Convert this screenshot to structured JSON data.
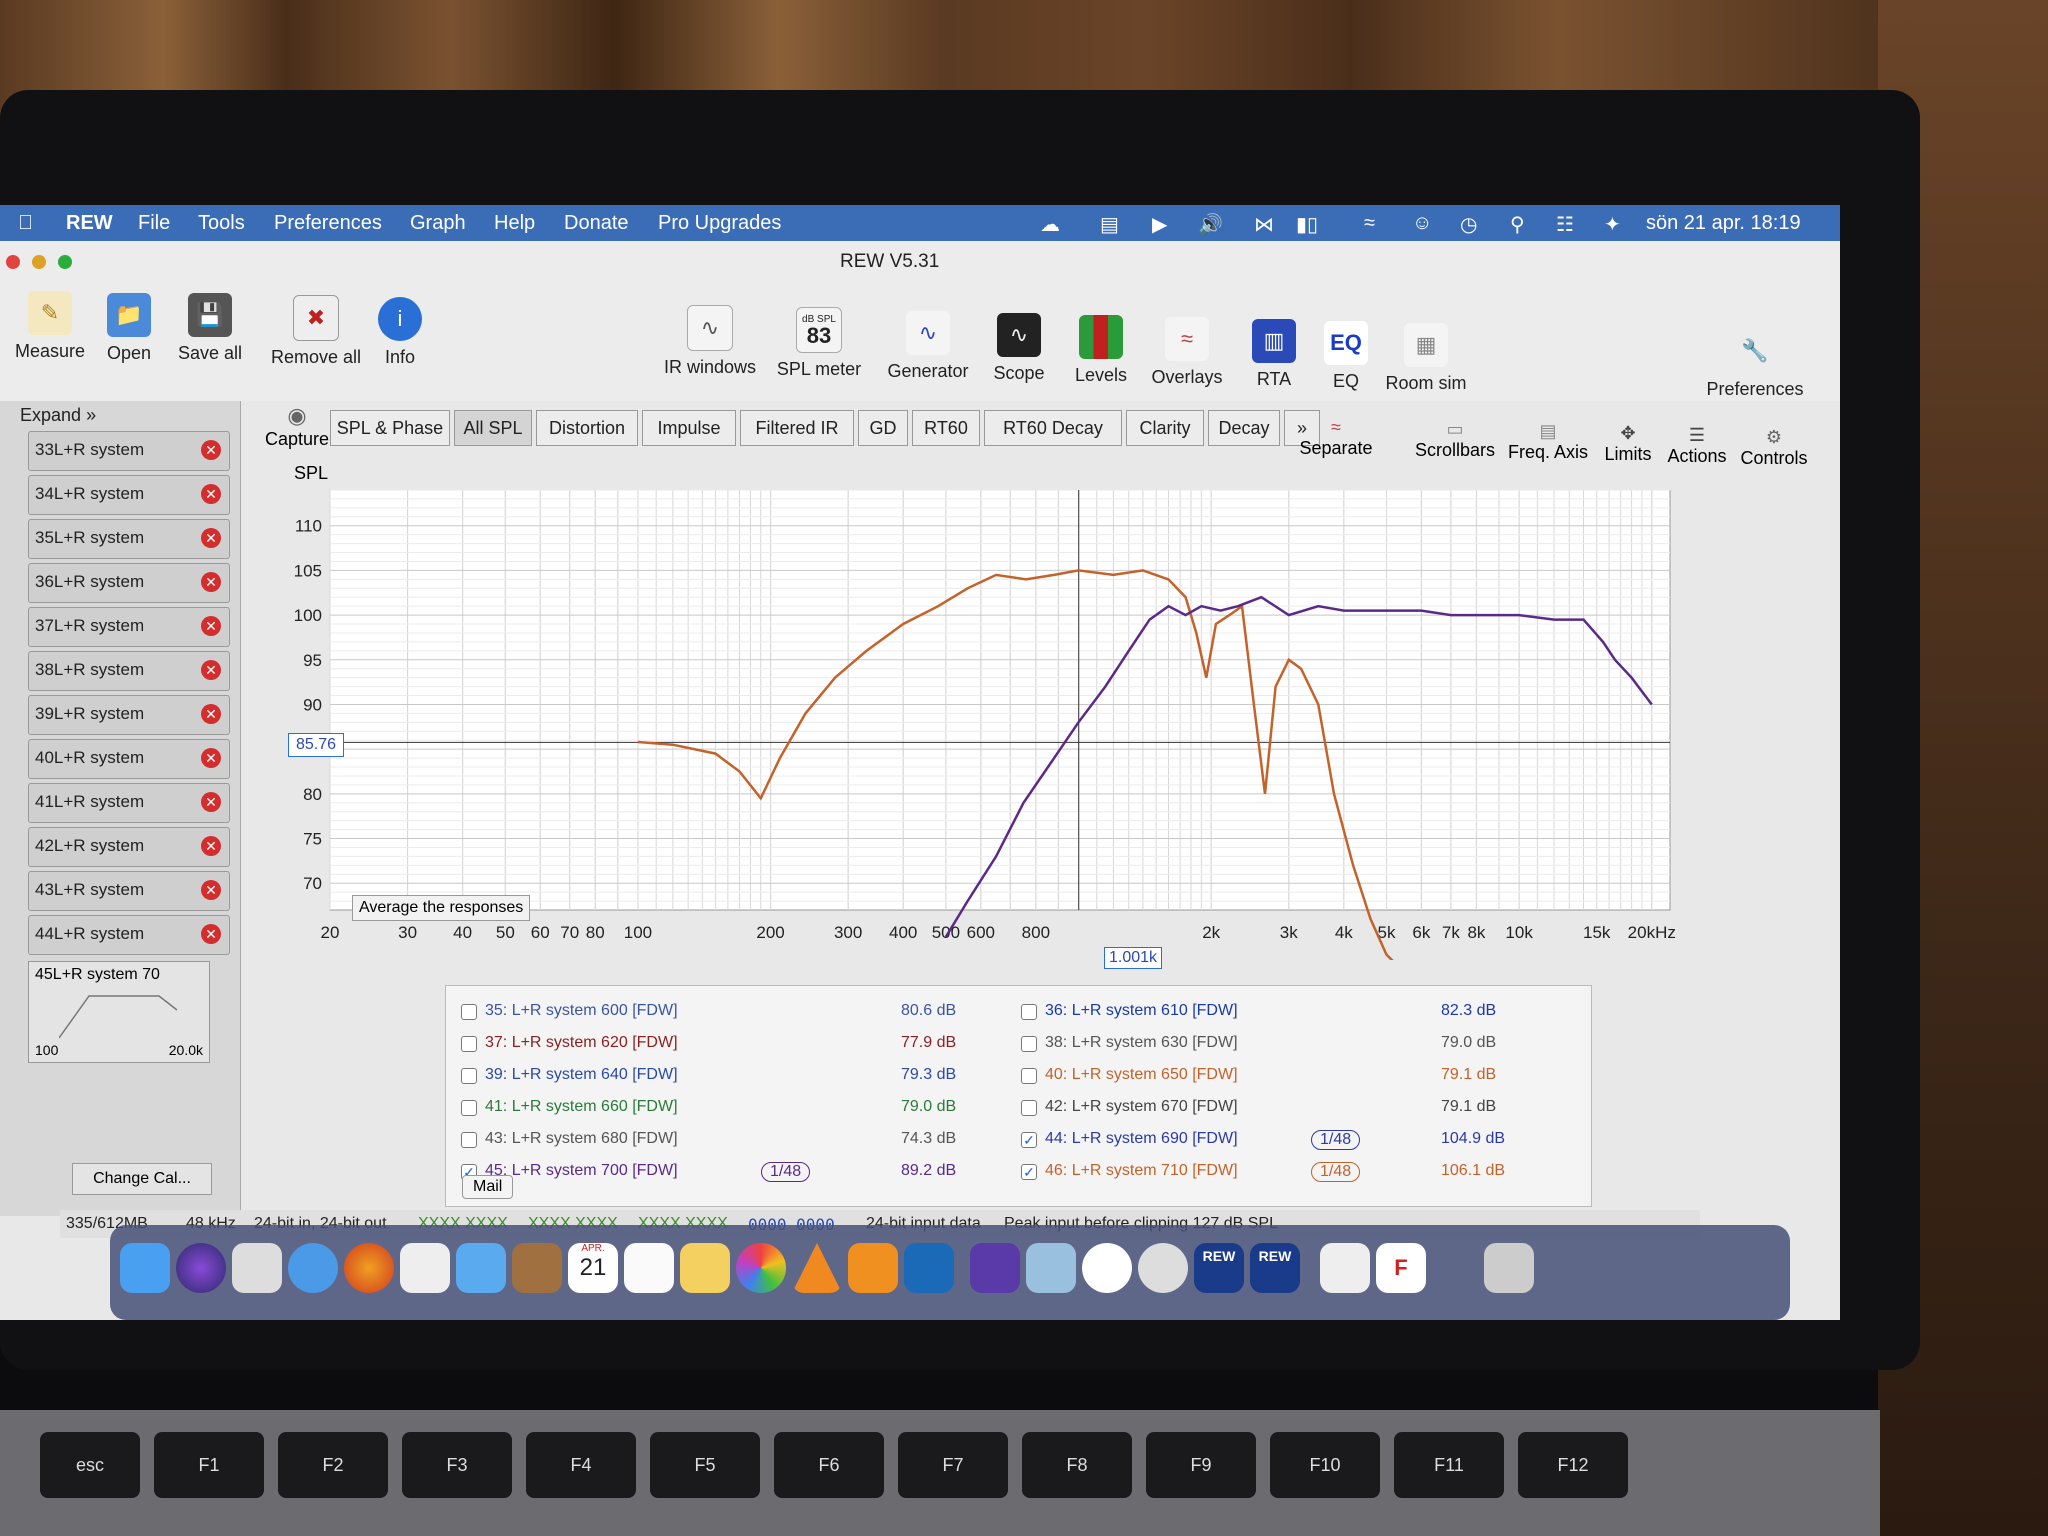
{
  "menubar": {
    "app": "REW",
    "items": [
      "File",
      "Tools",
      "Preferences",
      "Graph",
      "Help",
      "Donate",
      "Pro Upgrades"
    ],
    "clock": "sön 21 apr.  18:19"
  },
  "window": {
    "title": "REW V5.31"
  },
  "toolbar": {
    "left": [
      {
        "label": "Measure",
        "icon": "measure-icon"
      },
      {
        "label": "Open",
        "icon": "folder-icon"
      },
      {
        "label": "Save all",
        "icon": "save-icon"
      },
      {
        "label": "Remove all",
        "icon": "remove-icon"
      },
      {
        "label": "Info",
        "icon": "info-icon"
      }
    ],
    "center": [
      {
        "label": "IR windows",
        "icon": "ir-windows-icon"
      },
      {
        "label": "SPL meter",
        "icon": "spl-meter-icon",
        "value": "83",
        "unit": "dB SPL"
      },
      {
        "label": "Generator",
        "icon": "generator-icon"
      },
      {
        "label": "Scope",
        "icon": "scope-icon"
      },
      {
        "label": "Levels",
        "icon": "levels-icon"
      },
      {
        "label": "Overlays",
        "icon": "overlays-icon"
      },
      {
        "label": "RTA",
        "icon": "rta-icon"
      },
      {
        "label": "EQ",
        "icon": "eq-icon"
      },
      {
        "label": "Room sim",
        "icon": "room-sim-icon"
      }
    ],
    "right": {
      "label": "Preferences",
      "icon": "wrench-icon"
    }
  },
  "leftpanel": {
    "expand": "Expand",
    "measurements": [
      "33L+R system",
      "34L+R system",
      "35L+R system",
      "36L+R system",
      "37L+R system",
      "38L+R system",
      "39L+R system",
      "40L+R system",
      "41L+R system",
      "42L+R system",
      "43L+R system",
      "44L+R system"
    ],
    "selected": {
      "name": "45L+R system 70",
      "range_low": "100",
      "range_high": "20.0k"
    },
    "change_cal": "Change Cal..."
  },
  "graph_tabs": {
    "capture": "Capture",
    "tabs": [
      "SPL & Phase",
      "All SPL",
      "Distortion",
      "Impulse",
      "Filtered IR",
      "GD",
      "RT60",
      "RT60 Decay",
      "Clarity",
      "Decay",
      "»"
    ],
    "selected": "All SPL"
  },
  "graph_tools": [
    {
      "label": "Separate"
    },
    {
      "label": "Scrollbars"
    },
    {
      "label": "Freq. Axis"
    },
    {
      "label": "Limits"
    },
    {
      "label": "Actions"
    },
    {
      "label": "Controls"
    }
  ],
  "graph": {
    "ylabel": "SPL",
    "cursor_value": "85.76",
    "cursor_freq": "1.001k",
    "average_button": "Average the responses"
  },
  "chart_data": {
    "type": "line",
    "ylabel": "SPL",
    "xlabel": "",
    "x_unit": "kHz",
    "y_ticks": [
      "110",
      "105",
      "100",
      "95",
      "90",
      "80",
      "75",
      "70"
    ],
    "x_ticks": [
      "20",
      "30",
      "40",
      "50",
      "60",
      "70",
      "80",
      "100",
      "200",
      "300",
      "400",
      "500",
      "600",
      "800",
      "2k",
      "3k",
      "4k",
      "5k",
      "6k",
      "7k",
      "8k",
      "10k",
      "15k",
      "20kHz"
    ],
    "ylim": [
      67,
      114
    ],
    "xlim": [
      20,
      22000
    ],
    "x_scale": "log",
    "grid": true,
    "series": [
      {
        "color": "#c4622a",
        "x": [
          100,
          120,
          150,
          170,
          190,
          210,
          240,
          280,
          330,
          400,
          480,
          560,
          650,
          760,
          880,
          1000,
          1200,
          1400,
          1600,
          1750,
          1850,
          1950,
          2050,
          2200,
          2350,
          2500,
          2650,
          2800,
          3000,
          3200,
          3500,
          3800,
          4200,
          4600,
          5000,
          5500
        ],
        "y": [
          85.8,
          85.5,
          84.5,
          82.5,
          79.5,
          84,
          89,
          93,
          96,
          99,
          101,
          103,
          104.5,
          104,
          104.5,
          105,
          104.5,
          105,
          104,
          102,
          98,
          93,
          99,
          100,
          101,
          90,
          80,
          92,
          95,
          94,
          90,
          80,
          72,
          66,
          62,
          60
        ]
      },
      {
        "color": "#5a2a8a",
        "x": [
          500,
          560,
          650,
          750,
          880,
          1000,
          1150,
          1300,
          1450,
          1600,
          1750,
          1900,
          2100,
          2300,
          2600,
          3000,
          3500,
          4000,
          5000,
          6000,
          7000,
          8000,
          10000,
          12000,
          14000,
          15500,
          16500,
          18000,
          20000
        ],
        "y": [
          64,
          68,
          73,
          79,
          84,
          88,
          92,
          96,
          99.5,
          101,
          100,
          101,
          100.5,
          101,
          102,
          100,
          101,
          100.5,
          100.5,
          100.5,
          100,
          100,
          100,
          99.5,
          99.5,
          97,
          95,
          93,
          90
        ]
      }
    ]
  },
  "measurement_list": {
    "left": [
      {
        "name": "35: L+R system 600 [FDW]",
        "value": "80.6 dB",
        "color": "#3a55a0",
        "checked": false
      },
      {
        "name": "37: L+R system 620 [FDW]",
        "value": "77.9 dB",
        "color": "#8a2222",
        "checked": false
      },
      {
        "name": "39: L+R system 640 [FDW]",
        "value": "79.3 dB",
        "color": "#2a4aa8",
        "checked": false
      },
      {
        "name": "41: L+R system 660 [FDW]",
        "value": "79.0 dB",
        "color": "#2a7a3a",
        "checked": false
      },
      {
        "name": "43: L+R system 680 [FDW]",
        "value": "74.3 dB",
        "color": "#555555",
        "checked": false
      },
      {
        "name": "45: L+R system 700 [FDW]",
        "value": "89.2 dB",
        "color": "#5a2a8a",
        "checked": true,
        "smoothing": "1/48"
      }
    ],
    "right": [
      {
        "name": "36: L+R system 610 [FDW]",
        "value": "82.3 dB",
        "color": "#1a3aaa",
        "checked": false
      },
      {
        "name": "38: L+R system 630 [FDW]",
        "value": "79.0 dB",
        "color": "#555555",
        "checked": false
      },
      {
        "name": "40: L+R system 650 [FDW]",
        "value": "79.1 dB",
        "color": "#c4622a",
        "checked": false
      },
      {
        "name": "42: L+R system 670 [FDW]",
        "value": "79.1 dB",
        "color": "#444444",
        "checked": false
      },
      {
        "name": "44: L+R system 690 [FDW]",
        "value": "104.9 dB",
        "color": "#2a3aa8",
        "checked": true,
        "smoothing": "1/48"
      },
      {
        "name": "46: L+R system 710 [FDW]",
        "value": "106.1 dB",
        "color": "#c4622a",
        "checked": true,
        "smoothing": "1/48"
      }
    ]
  },
  "tooltip": "Mail",
  "status": {
    "memory": "335/612MB",
    "rate": "48 kHz",
    "bits": "24-bit in, 24-bit out",
    "mask1": "XXXX XXXX",
    "mask2": "XXXX XXXX",
    "mask3": "XXXX XXXX",
    "bits_pattern": "0000 0000",
    "input": "24-bit input data",
    "clip": "Peak input before clipping 127 dB SPL"
  },
  "dock": {
    "calendar_month": "APR.",
    "calendar_day": "21",
    "rew1": "REW",
    "rew2": "REW",
    "f3d": "F"
  },
  "keys": [
    "esc",
    "F1",
    "F2",
    "F3",
    "F4",
    "F5",
    "F6",
    "F7",
    "F8",
    "F9",
    "F10",
    "F11",
    "F12"
  ]
}
